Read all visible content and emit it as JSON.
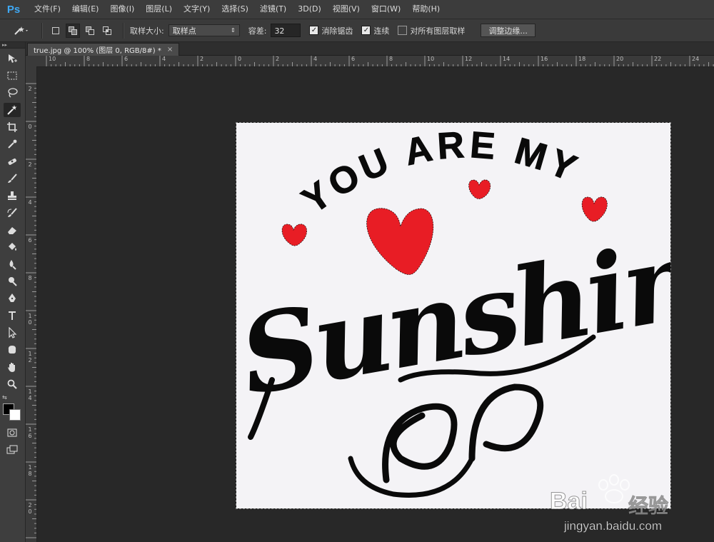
{
  "app": {
    "logo": "Ps"
  },
  "menu": {
    "items": [
      "文件(F)",
      "编辑(E)",
      "图像(I)",
      "图层(L)",
      "文字(Y)",
      "选择(S)",
      "滤镜(T)",
      "3D(D)",
      "视图(V)",
      "窗口(W)",
      "帮助(H)"
    ]
  },
  "options": {
    "sample_size_label": "取样大小:",
    "sample_size_value": "取样点",
    "tolerance_label": "容差:",
    "tolerance_value": "32",
    "antialias_label": "消除锯齿",
    "antialias_checked": true,
    "contiguous_label": "连续",
    "contiguous_checked": true,
    "sample_all_label": "对所有图层取样",
    "sample_all_checked": false,
    "refine_edge_label": "调整边缘..."
  },
  "document": {
    "tab_title": "true.jpg @ 100% (图层 0, RGB/8#) *",
    "close": "×"
  },
  "ruler": {
    "top_labels": [
      "10",
      "8",
      "6",
      "4",
      "2",
      "0",
      "2",
      "4",
      "6",
      "8",
      "10",
      "12",
      "14",
      "16",
      "18",
      "20",
      "22",
      "24"
    ],
    "left_labels": [
      "2",
      "0",
      "2",
      "4",
      "6",
      "8",
      "10",
      "12",
      "14",
      "16",
      "18",
      "20"
    ]
  },
  "artwork": {
    "line1": "YOU ARE MY",
    "line2": "Sunshine",
    "heart_color": "#e81d25",
    "ink_color": "#0a0a0a"
  },
  "watermark": {
    "brand": "Bai",
    "brand_suffix": "经验",
    "url": "jingyan.baidu.com"
  },
  "colors": {
    "foreground": "#000000",
    "background": "#ffffff",
    "accent": "#3fa9f5"
  },
  "tools": [
    "move-tool-icon",
    "marquee-tool-icon",
    "lasso-tool-icon",
    "magic-wand-tool-icon",
    "crop-tool-icon",
    "eyedropper-tool-icon",
    "healing-brush-icon",
    "brush-tool-icon",
    "clone-stamp-icon",
    "history-brush-icon",
    "eraser-tool-icon",
    "paint-bucket-icon",
    "blur-tool-icon",
    "dodge-tool-icon",
    "pen-tool-icon",
    "type-tool-icon",
    "path-selection-icon",
    "custom-shape-icon",
    "hand-tool-icon",
    "zoom-tool-icon"
  ]
}
